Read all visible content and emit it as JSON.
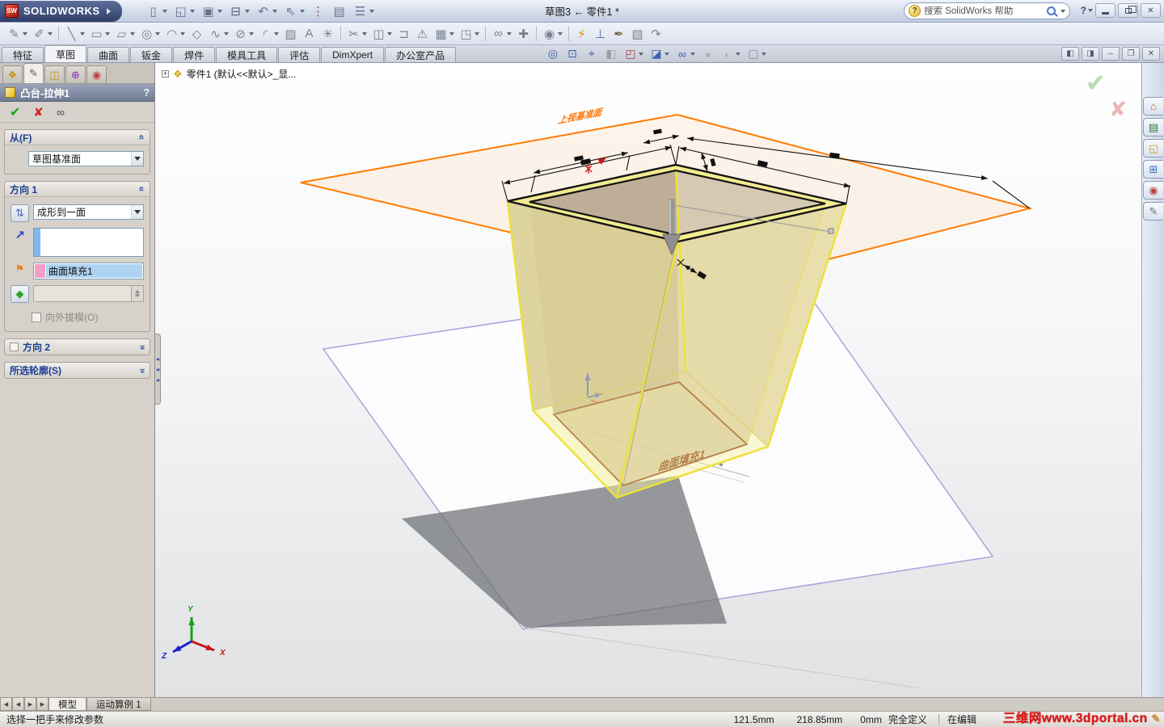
{
  "titlebar": {
    "logo_badge": "SW",
    "app_name": "SOLIDWORKS",
    "title": "草图3 ← 零件1 *",
    "search_placeholder": "搜索 SolidWorks 帮助",
    "help_glyph": "?",
    "close_glyph": "✕",
    "quick_icons": [
      {
        "name": "new-document",
        "glyph": "▯",
        "caret": true
      },
      {
        "name": "open",
        "glyph": "◱",
        "caret": true
      },
      {
        "name": "save",
        "glyph": "▣",
        "caret": true
      },
      {
        "name": "print",
        "glyph": "⊟",
        "caret": true,
        "color": "#55607a"
      },
      {
        "name": "undo",
        "glyph": "↶",
        "caret": true
      },
      {
        "name": "select",
        "glyph": "⇖",
        "caret": true
      },
      {
        "name": "rebuild",
        "glyph": "⋮",
        "color": "#9a4a4a"
      },
      {
        "name": "file-properties",
        "glyph": "▤"
      },
      {
        "name": "options",
        "glyph": "☰",
        "caret": true
      }
    ]
  },
  "sketch_toolbar": {
    "icons": [
      {
        "name": "sketch",
        "glyph": "✎",
        "caret": true
      },
      {
        "name": "smart-dimension",
        "glyph": "✐",
        "caret": true
      },
      {
        "name": "line",
        "glyph": "╲",
        "caret": true,
        "sep": true
      },
      {
        "name": "corner-rectangle",
        "glyph": "▭",
        "caret": true
      },
      {
        "name": "straight-slot",
        "glyph": "▱",
        "caret": true
      },
      {
        "name": "circle",
        "glyph": "◎",
        "caret": true
      },
      {
        "name": "centerpoint-arc",
        "glyph": "◠",
        "caret": true
      },
      {
        "name": "polygon",
        "glyph": "◇"
      },
      {
        "name": "spline",
        "glyph": "∿",
        "caret": true
      },
      {
        "name": "ellipse",
        "glyph": "⊘",
        "caret": true
      },
      {
        "name": "sketch-fillet",
        "glyph": "◜",
        "caret": true
      },
      {
        "name": "selection-region",
        "glyph": "▨"
      },
      {
        "name": "text",
        "glyph": "A"
      },
      {
        "name": "point",
        "glyph": "✳"
      },
      {
        "name": "trim-entities",
        "glyph": "✂",
        "caret": true,
        "sep": true
      },
      {
        "name": "convert-entities",
        "glyph": "◫",
        "caret": true
      },
      {
        "name": "offset-entities",
        "glyph": "⊐"
      },
      {
        "name": "mirror-entities",
        "glyph": "⚠"
      },
      {
        "name": "linear-sketch-pattern",
        "glyph": "▦",
        "caret": true
      },
      {
        "name": "move-entities",
        "glyph": "◳",
        "caret": true
      },
      {
        "name": "display-delete-relations",
        "glyph": "∞",
        "caret": true,
        "sep": true
      },
      {
        "name": "repair-sketch",
        "glyph": "✚"
      },
      {
        "name": "quick-snaps",
        "glyph": "◉",
        "caret": true,
        "sep": true
      },
      {
        "name": "rapid-sketch",
        "glyph": "⚡",
        "color": "#e09000",
        "sep": true
      },
      {
        "name": "no-solve-move",
        "glyph": "⊥",
        "color": "#4a6ab0"
      },
      {
        "name": "ink-sketch",
        "glyph": "✒",
        "color": "#7a6a40"
      },
      {
        "name": "sketch-picture",
        "glyph": "▧"
      },
      {
        "name": "instant2d",
        "glyph": "↷"
      }
    ]
  },
  "ribbon": {
    "tabs": [
      {
        "label": "特征"
      },
      {
        "label": "草图",
        "active": true
      },
      {
        "label": "曲面"
      },
      {
        "label": "钣金"
      },
      {
        "label": "焊件"
      },
      {
        "label": "模具工具"
      },
      {
        "label": "评估"
      },
      {
        "label": "DimXpert"
      },
      {
        "label": "办公室产品"
      }
    ]
  },
  "headsup": {
    "icons": [
      {
        "name": "zoom-to-fit",
        "glyph": "◎",
        "color": "#3a62b0"
      },
      {
        "name": "zoom-to-area",
        "glyph": "⊡",
        "color": "#3a62b0"
      },
      {
        "name": "previous-view",
        "glyph": "⌖",
        "color": "#3a62b0"
      },
      {
        "name": "section-view",
        "glyph": "◧",
        "color": "#9aa0a8"
      },
      {
        "name": "view-orientation",
        "glyph": "◰",
        "caret": true,
        "color": "#b04030"
      },
      {
        "name": "display-style",
        "glyph": "◪",
        "caret": true,
        "color": "#3a62b0"
      },
      {
        "name": "hide-show-items",
        "glyph": "∞",
        "caret": true,
        "color": "#3a62b0"
      },
      {
        "name": "edit-appearance",
        "glyph": "●",
        "color": "#b0b4ba"
      },
      {
        "name": "apply-scene",
        "glyph": "◐",
        "caret": true,
        "color": "#b0b4ba"
      },
      {
        "name": "view-settings",
        "glyph": "▢",
        "caret": true,
        "color": "#8a8f98"
      }
    ]
  },
  "doc_controls": [
    {
      "name": "pane-left",
      "glyph": "◧"
    },
    {
      "name": "pane-right",
      "glyph": "◨"
    },
    {
      "name": "doc-minimize",
      "glyph": "–"
    },
    {
      "name": "doc-restore",
      "glyph": "❐"
    },
    {
      "name": "doc-close",
      "glyph": "✕"
    }
  ],
  "pm": {
    "tabs": [
      {
        "name": "featuremanager-tab",
        "glyph": "❖",
        "color": "#c8941a"
      },
      {
        "name": "propertymanager-tab",
        "glyph": "✎",
        "color": "#555555",
        "active": true
      },
      {
        "name": "configurationmanager-tab",
        "glyph": "◫",
        "color": "#b8941f"
      },
      {
        "name": "dimxpertmanager-tab",
        "glyph": "⊕",
        "color": "#8a2cc0"
      },
      {
        "name": "displaymanager-tab",
        "glyph": "◉",
        "color": "#c04040"
      }
    ],
    "title": "凸台-拉伸1",
    "help": "?",
    "ok_glyph": "✔",
    "cancel_glyph": "✘",
    "preview_glyph": "∞",
    "chevron": "«",
    "splitter_glyph": "◂",
    "expander_glyph": "+",
    "from": {
      "label": "从(F)",
      "value": "草图基准面"
    },
    "dir1": {
      "label": "方向 1",
      "reverse_glyph": "⇅",
      "condition": "成形到一面",
      "ref_arrow_glyph": "↗",
      "face_glyph": "⚑",
      "selection": "曲面填充1",
      "draft_glyph": "◆",
      "draft_label": "向外拔模(O)"
    },
    "dir2": {
      "label": "方向 2"
    },
    "contours": {
      "label": "所选轮廓(S)"
    }
  },
  "tree": {
    "root": "零件1  (默认<<默认>_显..."
  },
  "viewport": {
    "plane_label": "上视基准面",
    "face_label": "曲面填充1",
    "triad": {
      "x": "X",
      "y": "Y",
      "z": "Z"
    }
  },
  "confirm": {
    "ok_glyph": "✔",
    "cancel_glyph": "✘"
  },
  "taskpane": {
    "tabs": [
      {
        "name": "solidworks-resources",
        "glyph": "⌂",
        "color": "#b06820"
      },
      {
        "name": "design-library",
        "glyph": "▤",
        "color": "#2e7a3a"
      },
      {
        "name": "file-explorer",
        "glyph": "◱",
        "color": "#d8a020"
      },
      {
        "name": "view-palette",
        "glyph": "⊞",
        "color": "#3a6fc4"
      },
      {
        "name": "appearances-scenes",
        "glyph": "◉",
        "color": "#c04040"
      },
      {
        "name": "custom-properties",
        "glyph": "✎",
        "color": "#6a7080"
      }
    ]
  },
  "bottom": {
    "nav": [
      {
        "name": "go-first",
        "glyph": "◀"
      },
      {
        "name": "go-prev",
        "glyph": "◀"
      },
      {
        "name": "go-next",
        "glyph": "▶"
      },
      {
        "name": "go-last",
        "glyph": "▶"
      }
    ],
    "tabs": [
      {
        "label": "模型",
        "active": true
      },
      {
        "label": "运动算例 1"
      }
    ]
  },
  "statusbar": {
    "message": "选择一把手来修改参数",
    "x": "121.5mm",
    "y": "218.85mm",
    "z": "0mm",
    "state": "完全定义",
    "editing": "在编辑",
    "watermark": "三维网www.3dportal.cn",
    "wm_icon": "✎"
  }
}
